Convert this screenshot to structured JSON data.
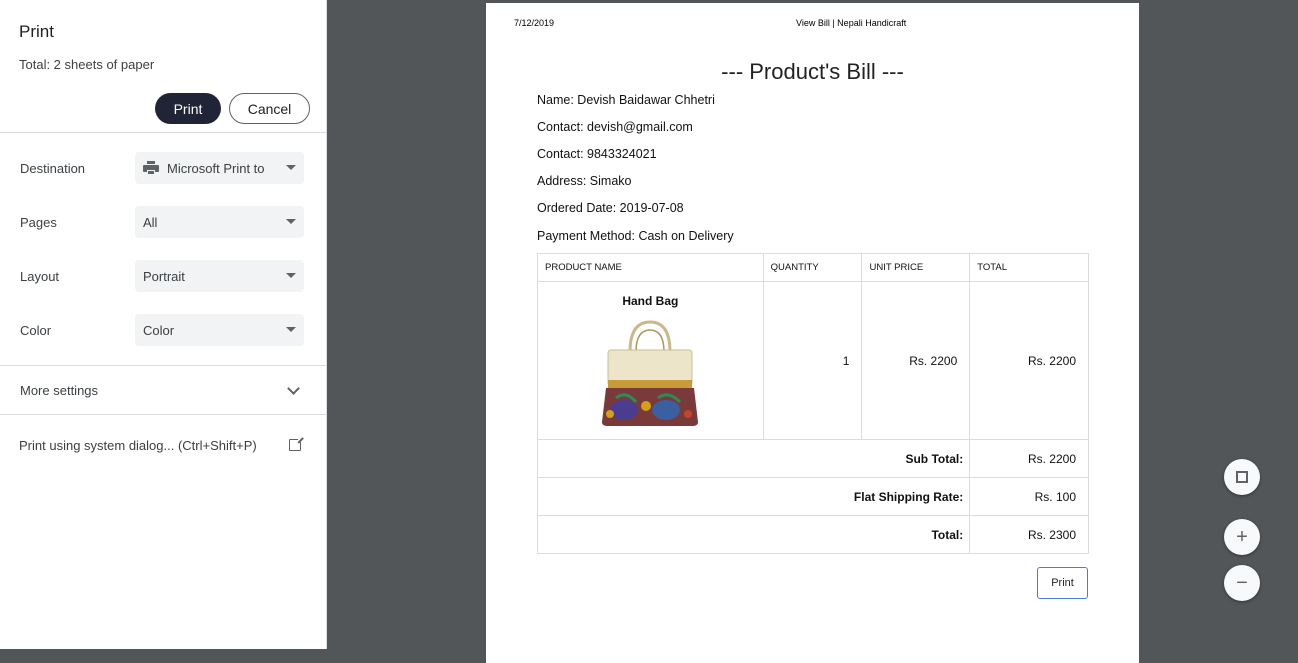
{
  "panel": {
    "title": "Print",
    "total": "Total: 2 sheets of paper",
    "print_label": "Print",
    "cancel_label": "Cancel",
    "settings": [
      {
        "label": "Destination",
        "value": "Microsoft Print to",
        "icon": "printer-icon"
      },
      {
        "label": "Pages",
        "value": "All"
      },
      {
        "label": "Layout",
        "value": "Portrait"
      },
      {
        "label": "Color",
        "value": "Color"
      }
    ],
    "more_settings": "More settings",
    "system_dialog": "Print using system dialog... (Ctrl+Shift+P)"
  },
  "page": {
    "header_date": "7/12/2019",
    "header_title": "View Bill | Nepali Handicraft",
    "bill_title": "--- Product's Bill ---",
    "info": [
      "Name: Devish Baidawar Chhetri",
      "Contact: devish@gmail.com",
      "Contact: 9843324021",
      "Address: Simako",
      "Ordered Date: 2019-07-08",
      "Payment Method: Cash on Delivery"
    ],
    "table": {
      "headers": [
        "PRODUCT NAME",
        "QUANTITY",
        "UNIT PRICE",
        "TOTAL"
      ],
      "row": {
        "product": "Hand Bag",
        "quantity": "1",
        "unit_price": "Rs. 2200",
        "total": "Rs. 2200"
      },
      "subtotal_label": "Sub Total:",
      "subtotal_value": "Rs. 2200",
      "shipping_label": "Flat Shipping Rate:",
      "shipping_value": "Rs. 100",
      "total_label": "Total:",
      "total_value": "Rs. 2300"
    },
    "print_button": "Print"
  },
  "zoom": {
    "zoom_in": "+",
    "zoom_out": "−"
  }
}
